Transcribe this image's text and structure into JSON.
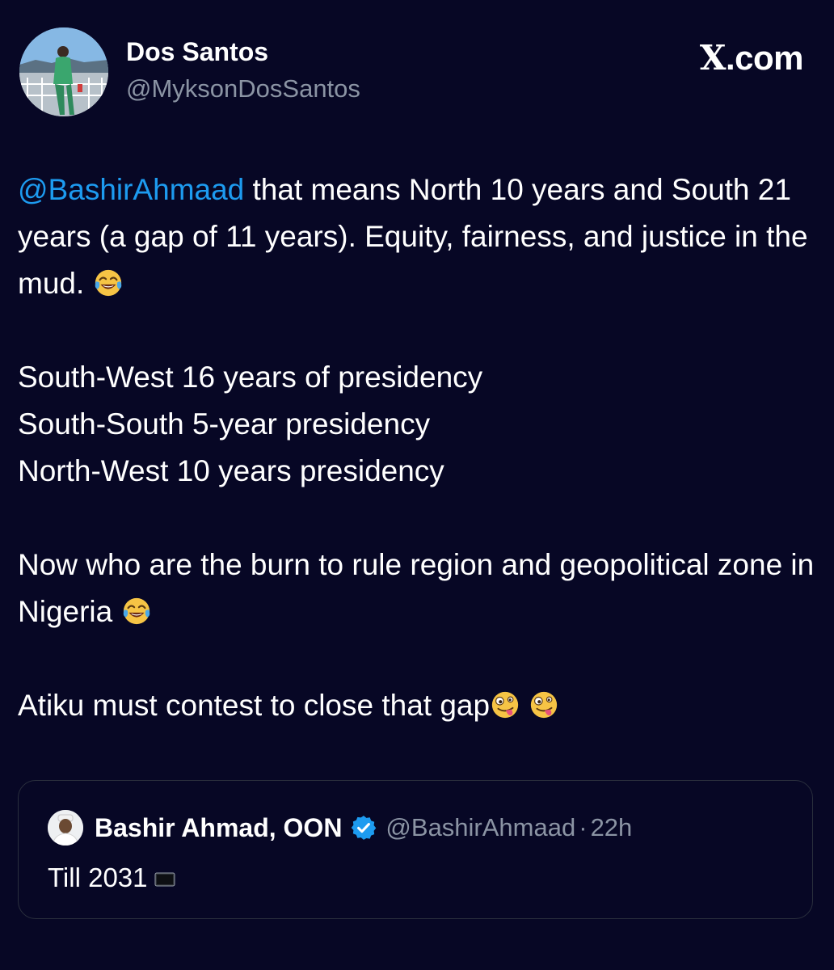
{
  "author": {
    "display_name": "Dos Santos",
    "handle": "@MyksonDosSantos"
  },
  "brand": {
    "x": "X",
    "rest": ".com"
  },
  "tweet": {
    "p1": {
      "mention": "@BashirAhmaad",
      "text": " that means North 10 years and South 21 years (a gap of 11 years). Equity, fairness, and justice in the mud. ",
      "emoji": "face-with-tears-of-joy"
    },
    "p2_lines": [
      "South-West 16 years of presidency",
      "South-South 5-year presidency",
      "North-West 10 years presidency"
    ],
    "p3": {
      "text": "Now who are the burn to rule region and geopolitical zone in Nigeria ",
      "emoji": "face-with-tears-of-joy"
    },
    "p4": {
      "text": "Atiku must contest to close that gap",
      "emojis": [
        "zany-face",
        "zany-face"
      ]
    }
  },
  "quoted_tweet": {
    "display_name": "Bashir Ahmad, OON",
    "verified": true,
    "handle": "@BashirAhmaad",
    "separator": "·",
    "time": "22h",
    "text": "Till 2031",
    "trailing_icon": "black-flag-icon"
  },
  "colors": {
    "background": "#070725",
    "mention": "#1d9bf0",
    "secondary_text": "#8b94a4",
    "verified": "#1d9bf0"
  }
}
